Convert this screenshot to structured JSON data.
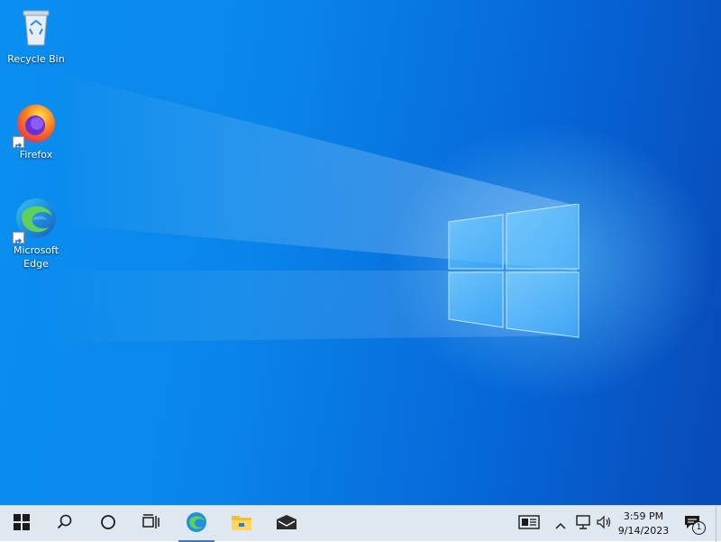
{
  "desktop": {
    "icons": [
      {
        "label": "Recycle Bin",
        "icon": "recycle-bin-icon"
      },
      {
        "label": "Firefox",
        "icon": "firefox-icon"
      },
      {
        "label": "Microsoft\nEdge",
        "icon": "edge-icon"
      }
    ]
  },
  "taskbar": {
    "start_icon": "windows-start-icon",
    "search_icon": "search-icon",
    "cortana_icon": "cortana-circle-icon",
    "task_view_icon": "task-view-icon",
    "pinned": [
      {
        "name": "Microsoft Edge",
        "icon": "edge-icon"
      },
      {
        "name": "File Explorer",
        "icon": "folder-icon"
      },
      {
        "name": "Mail",
        "icon": "mail-icon"
      }
    ],
    "tray": {
      "news_icon": "news-and-interests-icon",
      "chevron_icon": "chevron-up-icon",
      "network_icon": "network-icon",
      "volume_icon": "volume-icon",
      "time": "3:59 PM",
      "date": "9/14/2023",
      "notification_icon": "action-center-icon",
      "notification_count": "1"
    }
  },
  "colors": {
    "desktop_left": "#0a8ff0",
    "desktop_right": "#0849b8",
    "taskbar": "#dfe7ef"
  }
}
